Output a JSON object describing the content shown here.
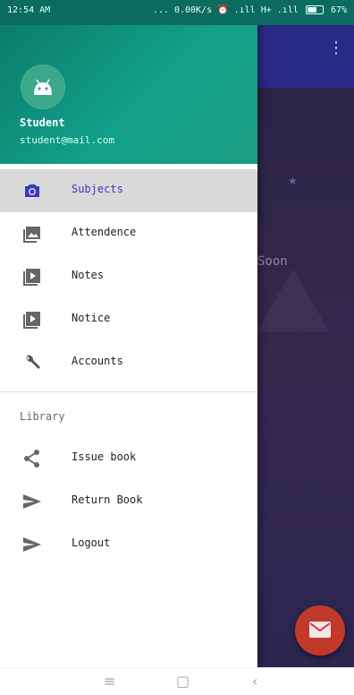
{
  "status_bar": {
    "time": "12:54 AM",
    "network_speed": "... 0.00K/s",
    "carrier": ".ıll H+ .ıll",
    "battery": "67%"
  },
  "drawer": {
    "user_name": "Student",
    "user_email": "student@mail.com",
    "items": [
      {
        "label": "Subjects",
        "icon": "camera-icon",
        "active": true
      },
      {
        "label": "Attendence",
        "icon": "image-icon",
        "active": false
      },
      {
        "label": "Notes",
        "icon": "play-box-icon",
        "active": false
      },
      {
        "label": "Notice",
        "icon": "play-box-icon",
        "active": false
      },
      {
        "label": "Accounts",
        "icon": "wrench-icon",
        "active": false
      }
    ],
    "section_title": "Library",
    "library_items": [
      {
        "label": "Issue book",
        "icon": "share-icon"
      },
      {
        "label": "Return Book",
        "icon": "send-icon"
      },
      {
        "label": "Logout",
        "icon": "send-icon"
      }
    ]
  },
  "app_background": {
    "partial_text": "Soon",
    "fab_icon": "mail-icon"
  },
  "navbar": {
    "menu_glyph": "≡",
    "home_glyph": "▢",
    "back_glyph": "‹"
  },
  "colors": {
    "header_start": "#0b7d6a",
    "header_end": "#1c9d82",
    "active_label": "#3a36c8",
    "toolbar": "#2a2a86",
    "fab": "#c0392b"
  }
}
